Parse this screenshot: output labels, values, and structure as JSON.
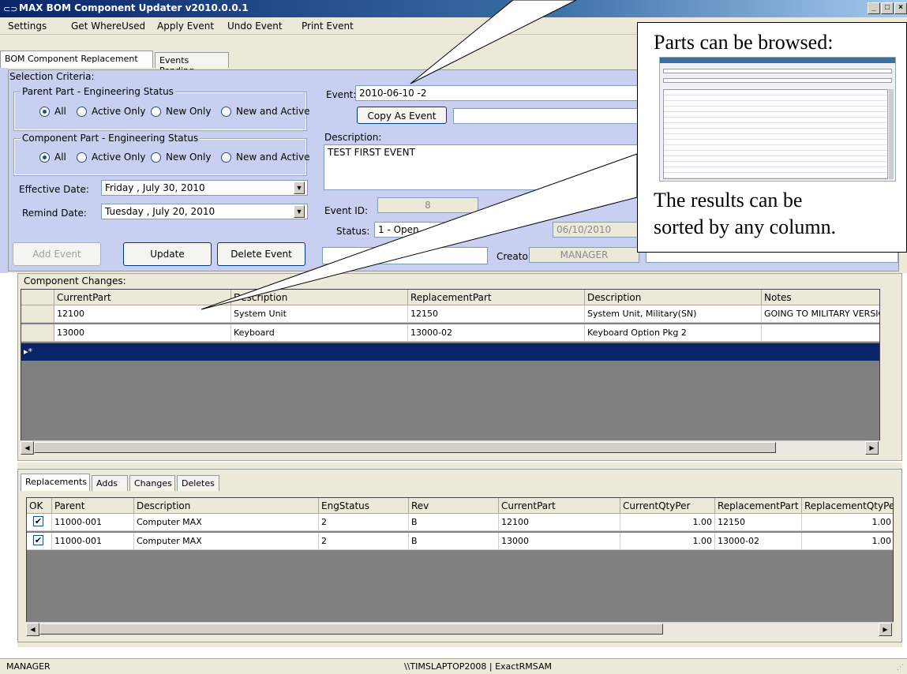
{
  "window": {
    "title": "MAX BOM Component Updater v2010.0.0.1"
  },
  "menu": [
    "Settings",
    "Get WhereUsed",
    "Apply Event",
    "Undo Event",
    "Print Event"
  ],
  "tabs": [
    "BOM Component Replacement",
    "Events Pending"
  ],
  "criteria": {
    "label": "Selection Criteria:",
    "parent_group": "Parent Part - Engineering Status",
    "component_group": "Component Part - Engineering Status",
    "radio_options": [
      "All",
      "Active Only",
      "New Only",
      "New and Active"
    ],
    "effective_label": "Effective Date:",
    "effective_value": "Friday   ,    July    30, 2010",
    "remind_label": "Remind Date:",
    "remind_value": "Tuesday  ,    July    20, 2010"
  },
  "event": {
    "event_label": "Event:",
    "event_value": "2010-06-10 -2",
    "copy_button": "Copy As Event",
    "description_label": "Description:",
    "description_value": "TEST FIRST EVENT",
    "id_label": "Event ID:",
    "id_value": "8",
    "status_label": "Status:",
    "status_value": "1 - Open",
    "date_value": "06/10/2010",
    "creator_label": "Creator:",
    "creator_value": "MANAGER"
  },
  "actions": {
    "add": "Add Event",
    "update": "Update",
    "delete": "Delete Event"
  },
  "component_changes": {
    "label": "Component Changes:",
    "columns": [
      "CurrentPart",
      "Description",
      "ReplacementPart",
      "Description",
      "Notes"
    ],
    "rows": [
      [
        "12100",
        "System Unit",
        "12150",
        "System Unit, Military(SN)",
        "GOING TO MILITARY VERSION"
      ],
      [
        "13000",
        "Keyboard",
        "13000-02",
        "Keyboard Option Pkg 2",
        ""
      ]
    ],
    "new_row_marker": "▸*"
  },
  "bottom_tabs": [
    "Replacements",
    "Adds",
    "Changes",
    "Deletes"
  ],
  "replacements": {
    "columns": [
      "OK",
      "Parent",
      "Description",
      "EngStatus",
      "Rev",
      "CurrentPart",
      "CurrentQtyPer",
      "ReplacementPart",
      "ReplacementQtyPe"
    ],
    "rows": [
      [
        "✔",
        "11000-001",
        "Computer MAX",
        "2",
        "B",
        "12100",
        "1.00",
        "12150",
        "1.00"
      ],
      [
        "✔",
        "11000-001",
        "Computer MAX",
        "2",
        "B",
        "13000",
        "1.00",
        "13000-02",
        "1.00"
      ]
    ]
  },
  "statusbar": {
    "user": "MANAGER",
    "server": "\\\\TIMSLAPTOP2008 | ExactRMSAM"
  },
  "callout": {
    "browse_text": "Parts can be browsed:",
    "results_line1": "The results can be",
    "results_line2": "sorted by any column."
  }
}
